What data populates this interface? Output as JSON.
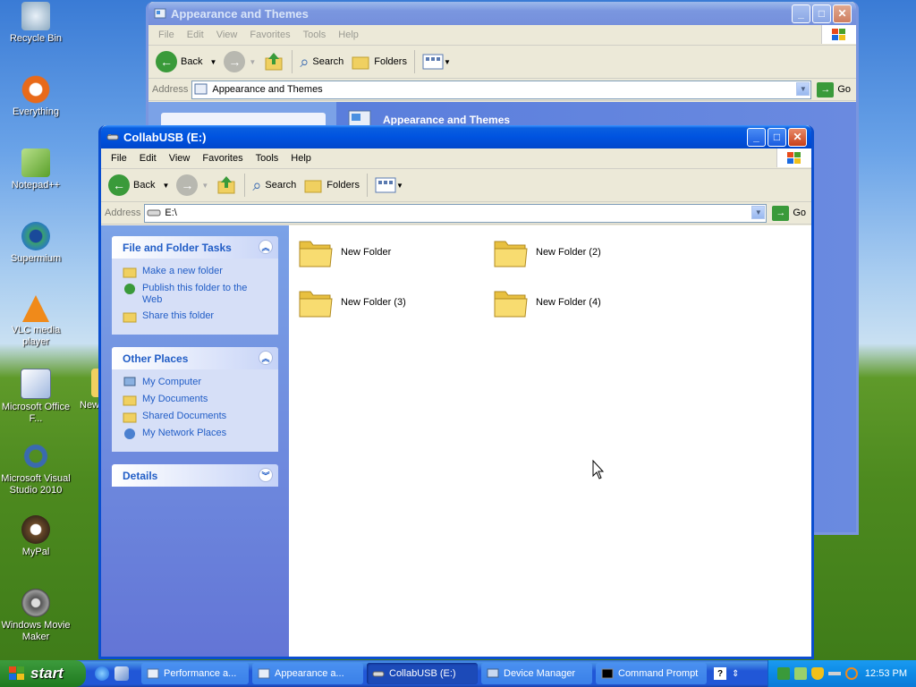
{
  "desktop": {
    "icons": [
      {
        "label": "Recycle Bin",
        "icon": "recycle-bin-icon"
      },
      {
        "label": "Everything",
        "icon": "everything-icon"
      },
      {
        "label": "Notepad++",
        "icon": "notepad-plus-plus-icon"
      },
      {
        "label": "Supermium",
        "icon": "supermium-icon"
      },
      {
        "label": "VLC media player",
        "icon": "vlc-icon"
      },
      {
        "label": "Microsoft Office F...",
        "icon": "office-icon"
      },
      {
        "label": "Microsoft Visual Studio 2010",
        "icon": "visual-studio-icon"
      },
      {
        "label": "MyPal",
        "icon": "mypal-icon"
      },
      {
        "label": "Windows Movie Maker",
        "icon": "movie-maker-icon"
      },
      {
        "label": "New",
        "icon": "folder-icon"
      }
    ]
  },
  "back_window": {
    "title": "Appearance and Themes",
    "menu": [
      "File",
      "Edit",
      "View",
      "Favorites",
      "Tools",
      "Help"
    ],
    "toolbar": {
      "back": "Back",
      "search": "Search",
      "folders": "Folders"
    },
    "address_label": "Address",
    "address_value": "Appearance and Themes",
    "go": "Go",
    "banner": "Appearance and Themes"
  },
  "front_window": {
    "title": "CollabUSB (E:)",
    "menu": [
      "File",
      "Edit",
      "View",
      "Favorites",
      "Tools",
      "Help"
    ],
    "toolbar": {
      "back": "Back",
      "search": "Search",
      "folders": "Folders"
    },
    "address_label": "Address",
    "address_value": "E:\\",
    "go": "Go",
    "tasks": {
      "title": "File and Folder Tasks",
      "items": [
        "Make a new folder",
        "Publish this folder to the Web",
        "Share this folder"
      ]
    },
    "other_places": {
      "title": "Other Places",
      "items": [
        "My Computer",
        "My Documents",
        "Shared Documents",
        "My Network Places"
      ]
    },
    "details": {
      "title": "Details"
    },
    "folders": [
      "New Folder",
      "New Folder (2)",
      "New Folder (3)",
      "New Folder (4)"
    ]
  },
  "taskbar": {
    "start": "start",
    "items": [
      {
        "label": "Performance a...",
        "active": false
      },
      {
        "label": "Appearance a...",
        "active": false
      },
      {
        "label": "CollabUSB (E:)",
        "active": true
      },
      {
        "label": "Device Manager",
        "active": false
      },
      {
        "label": "Command Prompt",
        "active": false
      }
    ],
    "clock": "12:53 PM"
  },
  "colors": {
    "accent": "#0a4ecf",
    "taskpane_link": "#215dc6",
    "start_green": "#2e8a2e"
  }
}
